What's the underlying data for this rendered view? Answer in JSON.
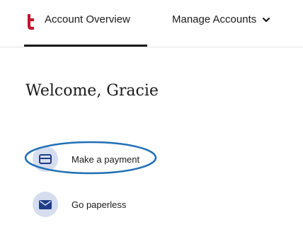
{
  "nav": {
    "tabs": [
      {
        "label": "Account Overview",
        "active": true
      },
      {
        "label": "Manage Accounts",
        "has_dropdown": true
      }
    ]
  },
  "welcome": {
    "text": "Welcome, Gracie"
  },
  "actions": [
    {
      "label": "Make a payment",
      "icon": "credit-card-icon",
      "highlighted": true
    },
    {
      "label": "Go paperless",
      "icon": "envelope-icon"
    }
  ],
  "colors": {
    "brand_red": "#c8102e",
    "icon_bg": "#d5ddef",
    "icon_fg": "#1f3c88",
    "highlight_ring": "#1f6fb5",
    "text": "#1a1a1a"
  }
}
